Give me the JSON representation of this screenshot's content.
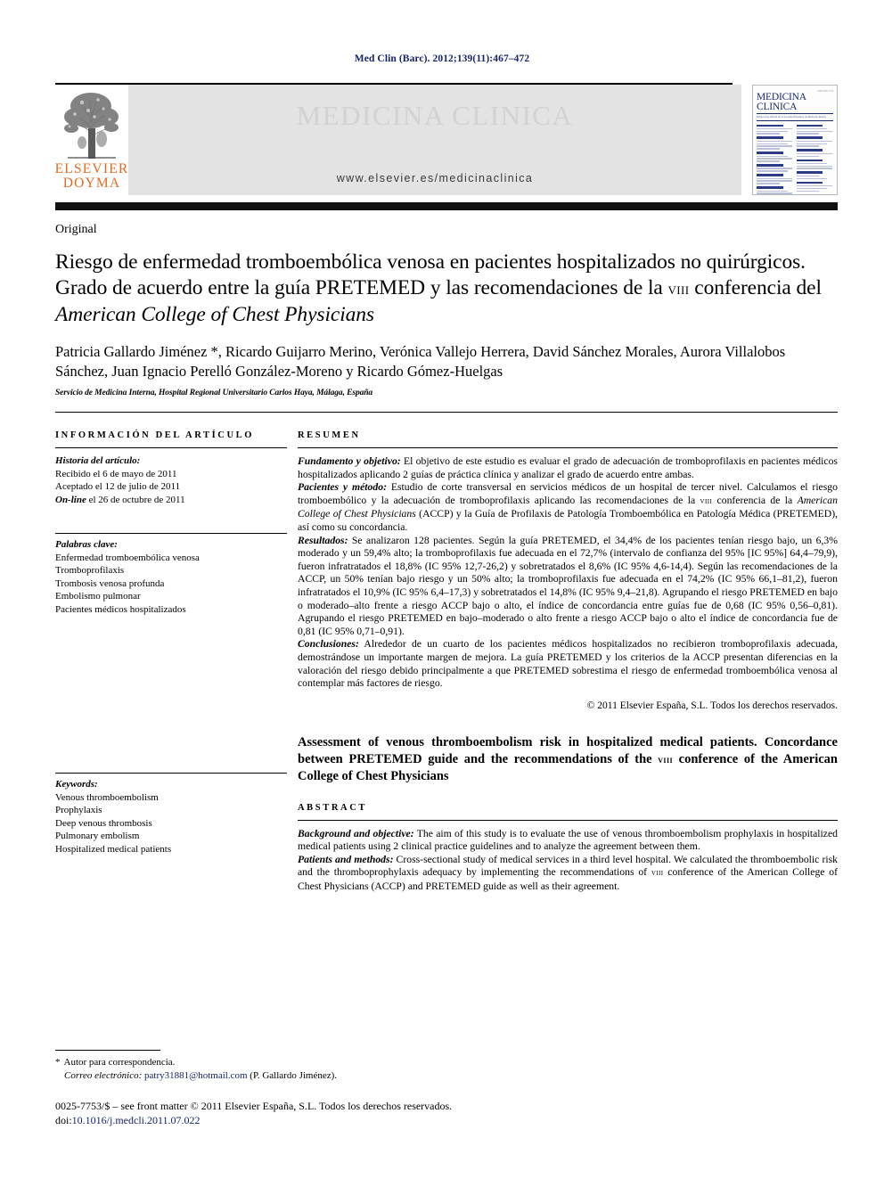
{
  "running_head": "Med Clin (Barc). 2012;139(11):467–472",
  "journal_header": {
    "publisher_line1": "ELSEVIER",
    "publisher_line2": "DOYMA",
    "masthead_title": "MEDICINA CLINICA",
    "url": "www.elsevier.es/medicinaclinica",
    "cover_title_line1": "MEDICINA",
    "cover_title_line2": "CLINICA",
    "cover_subline": "Publicación Oficial de la Sociedad Española de Medicina Interna"
  },
  "article": {
    "kind": "Original",
    "title_part1": "Riesgo de enfermedad tromboembólica venosa en pacientes hospitalizados no quirúrgicos. Grado de acuerdo entre la guía PRETEMED y las recomendaciones de la ",
    "title_numeral": "viii",
    "title_part2": " conferencia del ",
    "title_italic": "American College of Chest Physicians",
    "authors": "Patricia Gallardo Jiménez *, Ricardo Guijarro Merino, Verónica Vallejo Herrera, David Sánchez Morales, Aurora Villalobos Sánchez, Juan Ignacio Perelló González-Moreno y Ricardo Gómez-Huelgas",
    "affiliation": "Servicio de Medicina Interna, Hospital Regional Universitario Carlos Haya, Málaga, España"
  },
  "info_panel": {
    "heading": "INFORMACIÓN DEL ARTÍCULO",
    "history_label": "Historia del artículo:",
    "history": [
      "Recibido el 6 de mayo de 2011",
      "Aceptado el 12 de julio de 2011"
    ],
    "online_label": "On-line",
    "online_rest": " el 26 de octubre de 2011",
    "keywords_label": "Palabras clave:",
    "keywords": [
      "Enfermedad tromboembólica venosa",
      "Tromboprofilaxis",
      "Trombosis venosa profunda",
      "Embolismo pulmonar",
      "Pacientes médicos hospitalizados"
    ],
    "en_keywords_label": "Keywords:",
    "en_keywords": [
      "Venous thromboembolism",
      "Prophylaxis",
      "Deep venous thrombosis",
      "Pulmonary embolism",
      "Hospitalized medical patients"
    ]
  },
  "abstract_es": {
    "heading": "RESUMEN",
    "objective_label": "Fundamento y objetivo:",
    "objective_text": " El objetivo de este estudio es evaluar el grado de adecuación de tromboprofilaxis en pacientes médicos hospitalizados aplicando 2 guías de práctica clínica y analizar el grado de acuerdo entre ambas.",
    "methods_label": "Pacientes y método:",
    "methods_text_a": " Estudio de corte transversal en servicios médicos de un hospital de tercer nivel. Calculamos el riesgo tromboembólico y la adecuación de tromboprofilaxis aplicando las recomendaciones de la ",
    "methods_numeral": "viii",
    "methods_text_b": " conferencia de la ",
    "methods_italic": "American College of Chest Physicians",
    "methods_text_c": " (ACCP) y la Guía de Profilaxis de Patología Tromboembólica en Patología Médica (PRETEMED), así como su concordancia.",
    "results_label": "Resultados:",
    "results_text": " Se analizaron 128 pacientes. Según la guía PRETEMED, el 34,4% de los pacientes tenían riesgo bajo, un 6,3% moderado y un 59,4% alto; la tromboprofilaxis fue adecuada en el 72,7% (intervalo de confianza del 95% [IC 95%] 64,4–79,9), fueron infratratados el 18,8% (IC 95% 12,7-26,2) y sobretratados el 8,6% (IC 95% 4,6-14,4). Según las recomendaciones de la ACCP, un 50% tenían bajo riesgo y un 50% alto; la tromboprofilaxis fue adecuada en el 74,2% (IC 95% 66,1–81,2), fueron infratratados el 10,9% (IC 95% 6,4–17,3) y sobretratados el 14,8% (IC 95% 9,4–21,8). Agrupando el riesgo PRETEMED en bajo o moderado–alto frente a riesgo ACCP bajo o alto, el índice de concordancia entre guías fue de 0,68 (IC 95% 0,56–0,81). Agrupando el riesgo PRETEMED en bajo–moderado o alto frente a riesgo ACCP bajo o alto el índice de concordancia fue de 0,81 (IC 95% 0,71–0,91).",
    "conclusions_label": "Conclusiones:",
    "conclusions_text": " Alrededor de un cuarto de los pacientes médicos hospitalizados no recibieron tromboprofilaxis adecuada, demostrándose un importante margen de mejora. La guía PRETEMED y los criterios de la ACCP presentan diferencias en la valoración del riesgo debido principalmente a que PRETEMED sobrestima el riesgo de enfermedad tromboembólica venosa al contemplar más factores de riesgo.",
    "copyright": "© 2011 Elsevier España, S.L. Todos los derechos reservados."
  },
  "abstract_en": {
    "title_part1": "Assessment of venous thromboembolism risk in hospitalized medical patients. Concordance between PRETEMED guide and the recommendations of the ",
    "title_numeral": "viii",
    "title_part2": " conference of the American College of Chest Physicians",
    "heading": "ABSTRACT",
    "objective_label": "Background and objective:",
    "objective_text": " The aim of this study is to evaluate the use of venous thromboembolism prophylaxis in hospitalized medical patients using 2 clinical practice guidelines and to analyze the agreement between them.",
    "methods_label": "Patients and methods:",
    "methods_text_a": " Cross-sectional study of medical services in a third level hospital. We calculated the thromboembolic risk and the thromboprophylaxis adequacy by implementing the recommendations of ",
    "methods_numeral": "viii",
    "methods_text_b": " conference of the American College of Chest Physicians (ACCP) and PRETEMED guide as well as their agreement."
  },
  "footer": {
    "corr_marker": "*",
    "corr_label": "Autor para correspondencia.",
    "email_label": "Correo electrónico:",
    "email": "patry31881@hotmail.com",
    "email_owner": " (P. Gallardo Jiménez).",
    "issn_line": "0025-7753/$ – see front matter © 2011 Elsevier España, S.L. Todos los derechos reservados.",
    "doi_label": "doi:",
    "doi": "10.1016/j.medcli.2011.07.022"
  },
  "colors": {
    "link_navy": "#16246b",
    "elsevier_orange": "#E06C23",
    "masthead_gray": "#e3e3e3",
    "cover_navy": "#1b2a6b"
  }
}
